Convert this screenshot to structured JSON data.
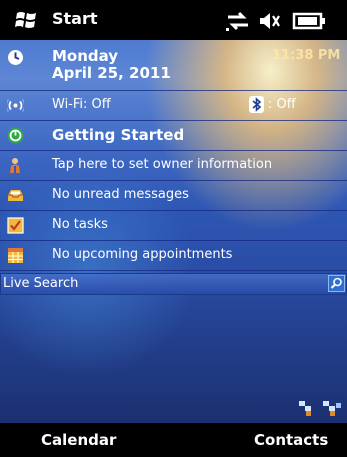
{
  "titlebar": {
    "title": "Start"
  },
  "today": {
    "date": {
      "day": "Monday",
      "full_date": "April 25, 2011",
      "clock": "11:38 PM"
    },
    "wireless": {
      "wifi_label": "Wi-Fi: Off",
      "bluetooth_label": ": Off"
    },
    "getting_started": "Getting Started",
    "owner": "Tap here to set owner information",
    "messages": "No unread messages",
    "tasks": "No tasks",
    "appointments": "No upcoming appointments",
    "search": {
      "label": "Live Search"
    }
  },
  "softkeys": {
    "left": "Calendar",
    "right": "Contacts"
  }
}
